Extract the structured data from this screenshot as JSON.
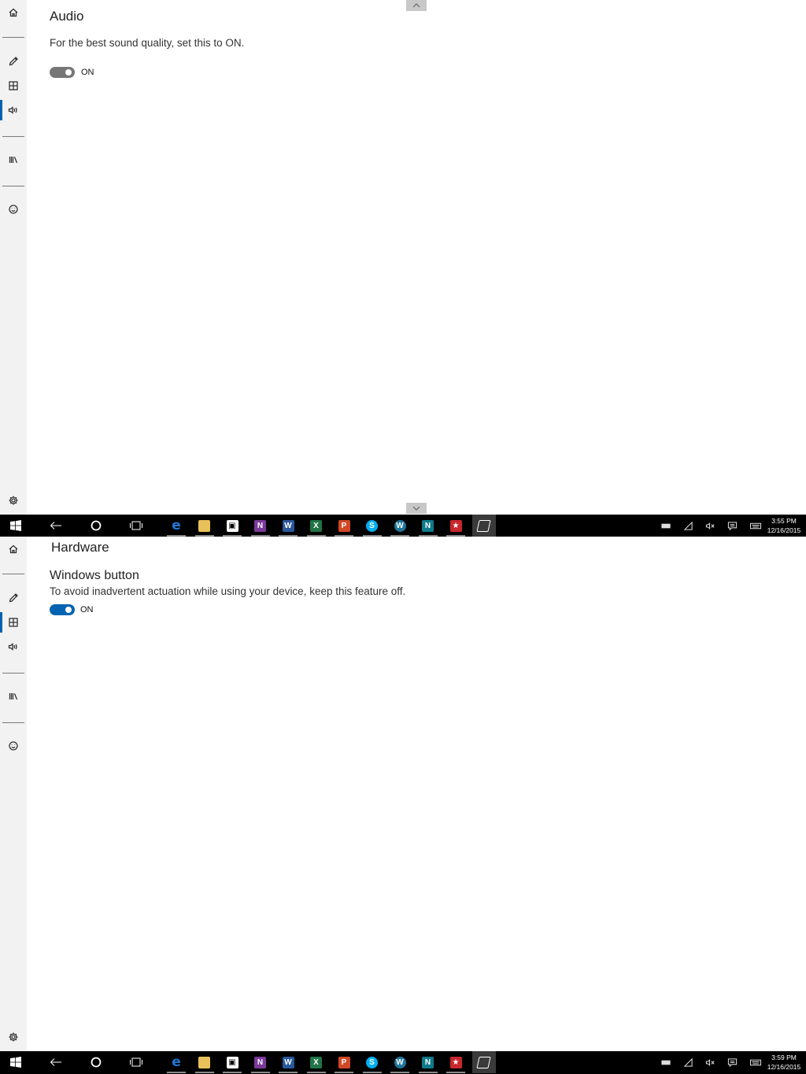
{
  "top": {
    "page_title": "Audio",
    "description": "For the best sound quality, set this to ON.",
    "toggle_label": "ON",
    "active_nav": "audio",
    "clock_time": "3:55 PM",
    "clock_date": "12/16/2015"
  },
  "bottom": {
    "page_title": "Hardware",
    "setting_title": "Windows button",
    "description": "To avoid inadvertent actuation while using your device, keep this feature off.",
    "toggle_label": "ON",
    "active_nav": "hardware",
    "clock_time": "3:59 PM",
    "clock_date": "12/16/2015"
  },
  "sidebar": {
    "items": [
      {
        "name": "home-icon"
      },
      {
        "name": "pen-icon"
      },
      {
        "name": "grid-icon"
      },
      {
        "name": "speaker-icon"
      },
      {
        "name": "library-icon"
      },
      {
        "name": "smiley-icon"
      },
      {
        "name": "gear-icon"
      }
    ]
  },
  "taskbar": {
    "apps": [
      {
        "name": "edge-icon",
        "glyph": "e",
        "color": "#1e78d7"
      },
      {
        "name": "file-explorer-icon",
        "glyph": "",
        "color": "#e8c15a"
      },
      {
        "name": "store-icon",
        "glyph": "",
        "color": "#ffffff"
      },
      {
        "name": "onenote-icon",
        "glyph": "N",
        "color": "#7a3a9a"
      },
      {
        "name": "word-icon",
        "glyph": "W",
        "color": "#2b579a"
      },
      {
        "name": "excel-icon",
        "glyph": "X",
        "color": "#217346"
      },
      {
        "name": "powerpoint-icon",
        "glyph": "P",
        "color": "#d24726"
      },
      {
        "name": "skype-icon",
        "glyph": "S",
        "color": "#00aff0"
      },
      {
        "name": "wordpress-icon",
        "glyph": "W",
        "color": "#21759b"
      },
      {
        "name": "news-icon",
        "glyph": "N",
        "color": "#0f7a8a"
      },
      {
        "name": "red-app-icon",
        "glyph": "★",
        "color": "#c8272d"
      },
      {
        "name": "surface-pen-app-icon",
        "glyph": "",
        "color": "#3a3a3a"
      }
    ],
    "accent": "#0063b1"
  }
}
